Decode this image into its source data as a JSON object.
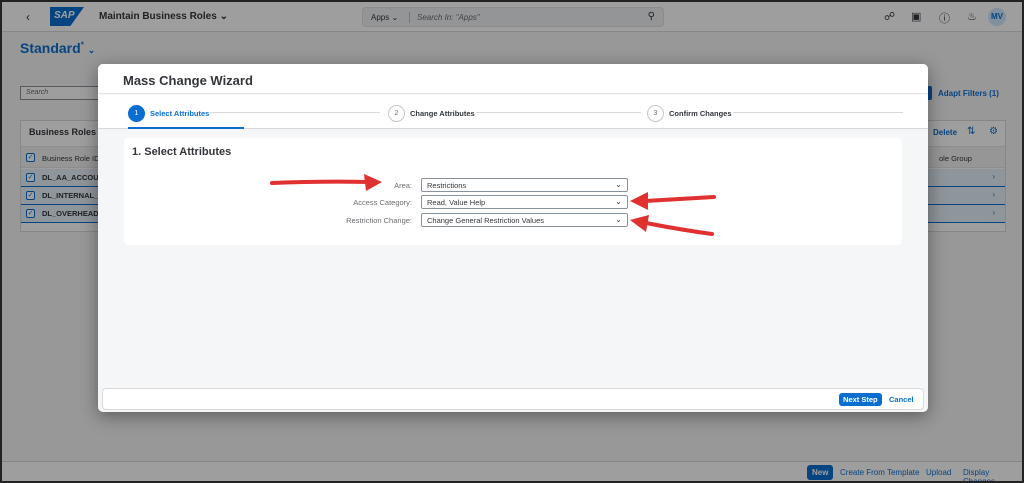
{
  "shell": {
    "logo": "SAP",
    "app_title": "Maintain Business Roles",
    "search_scope": "Apps",
    "search_placeholder": "Search In: \"Apps\"",
    "avatar_initials": "MV"
  },
  "background": {
    "variant_title": "Standard",
    "variant_mark": "*",
    "search_placeholder": "Search",
    "adapt_filters": "Adapt Filters (1)",
    "table_title": "Business Roles (3",
    "delete": "Delete",
    "col_name": "Business Role ID",
    "col_group": "ole Group",
    "rows": [
      "DL_AA_ACCOU",
      "DL_INTERNAL_",
      "DL_OVERHEAD"
    ],
    "footer": {
      "new": "New",
      "create_from_template": "Create From Template",
      "upload": "Upload",
      "display_changes": "Display Changes"
    }
  },
  "dialog": {
    "title": "Mass Change Wizard",
    "steps": [
      {
        "num": "1",
        "label": "Select Attributes"
      },
      {
        "num": "2",
        "label": "Change Attributes"
      },
      {
        "num": "3",
        "label": "Confirm Changes"
      }
    ],
    "section_title": "1. Select Attributes",
    "fields": [
      {
        "label": "Area:",
        "value": "Restrictions"
      },
      {
        "label": "Access Category:",
        "value": "Read, Value Help"
      },
      {
        "label": "Restriction Change:",
        "value": "Change General Restriction Values"
      }
    ],
    "next_step": "Next Step",
    "cancel": "Cancel"
  },
  "colors": {
    "accent": "#0a6ed1",
    "arrow": "#e03030"
  }
}
